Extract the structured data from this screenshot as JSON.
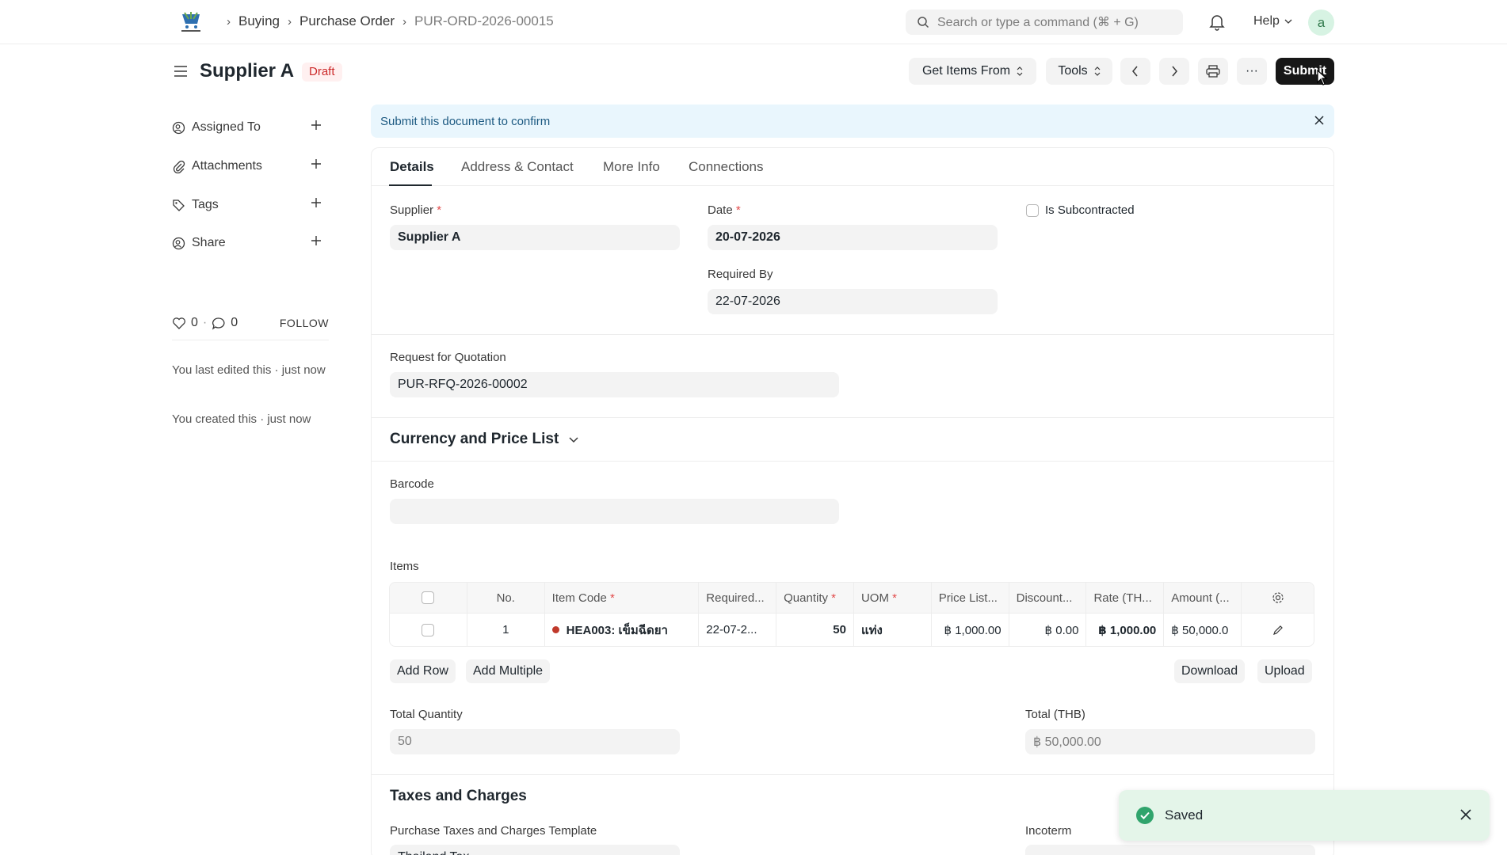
{
  "navbar": {
    "breadcrumbs": [
      "Buying",
      "Purchase Order",
      "PUR-ORD-2026-00015"
    ],
    "search_placeholder": "Search or type a command (⌘ + G)",
    "help_label": "Help",
    "avatar_initial": "a"
  },
  "page": {
    "title": "Supplier A",
    "status": "Draft",
    "buttons": {
      "get_items_from": "Get Items From",
      "tools": "Tools",
      "more": "···",
      "submit": "Submit"
    }
  },
  "sidebar": {
    "items": [
      "Assigned To",
      "Attachments",
      "Tags",
      "Share"
    ],
    "likes": "0",
    "comments": "0",
    "follow": "FOLLOW",
    "last_edited": "You last edited this · just now",
    "created": "You created this · just now"
  },
  "alert": {
    "text": "Submit this document to confirm"
  },
  "tabs": [
    "Details",
    "Address & Contact",
    "More Info",
    "Connections"
  ],
  "form": {
    "supplier_label": "Supplier",
    "supplier_value": "Supplier A",
    "date_label": "Date",
    "date_value": "20-07-2026",
    "required_by_label": "Required By",
    "required_by_value": "22-07-2026",
    "is_subcontracted_label": "Is Subcontracted",
    "rfq_label": "Request for Quotation",
    "rfq_value": "PUR-RFQ-2026-00002",
    "currency_section": "Currency and Price List",
    "barcode_label": "Barcode",
    "items_label": "Items",
    "total_quantity_label": "Total Quantity",
    "total_quantity_value": "50",
    "total_thb_label": "Total (THB)",
    "total_thb_value": "฿ 50,000.00",
    "taxes_section": "Taxes and Charges",
    "taxes_template_label": "Purchase Taxes and Charges Template",
    "taxes_template_value": "Thailand Tax",
    "incoterm_label": "Incoterm"
  },
  "items_table": {
    "headers": [
      "No.",
      "Item Code",
      "Required...",
      "Quantity",
      "UOM",
      "Price List...",
      "Discount...",
      "Rate (TH...",
      "Amount (..."
    ],
    "rows": [
      {
        "no": "1",
        "item_code": "HEA003: เข็มฉีดยา",
        "required": "22-07-2...",
        "quantity": "50",
        "uom": "แท่ง",
        "price_list": "฿ 1,000.00",
        "discount": "฿ 0.00",
        "rate": "฿ 1,000.00",
        "amount": "฿ 50,000.0"
      }
    ],
    "buttons": {
      "add_row": "Add Row",
      "add_multiple": "Add Multiple",
      "download": "Download",
      "upload": "Upload"
    }
  },
  "toast": {
    "message": "Saved"
  },
  "colors": {
    "accent": "#171717",
    "draft": "#cc2929",
    "success": "#30a46c",
    "alert_bg": "#e9f6fd"
  }
}
